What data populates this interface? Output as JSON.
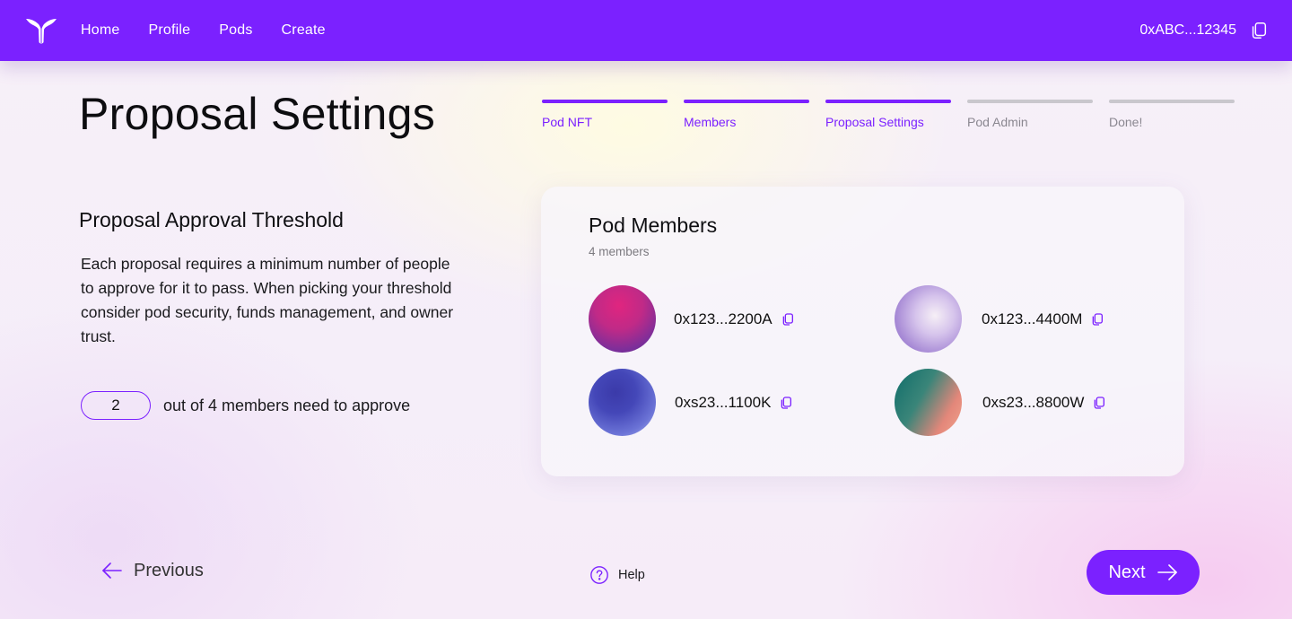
{
  "app": {
    "name": "Pods"
  },
  "nav": {
    "items": [
      {
        "label": "Home"
      },
      {
        "label": "Profile"
      },
      {
        "label": "Pods"
      },
      {
        "label": "Create"
      }
    ],
    "wallet": "0xABC...12345"
  },
  "page": {
    "title": "Proposal Settings"
  },
  "stepper": {
    "steps": [
      {
        "label": "Pod NFT",
        "state": "done"
      },
      {
        "label": "Members",
        "state": "done"
      },
      {
        "label": "Proposal Settings",
        "state": "active"
      },
      {
        "label": "Pod Admin",
        "state": "pending"
      },
      {
        "label": "Done!",
        "state": "pending"
      }
    ]
  },
  "threshold": {
    "title": "Proposal Approval Threshold",
    "description": "Each proposal requires a minimum number of people to approve for it to pass. When picking your threshold consider pod security, funds management, and owner trust.",
    "value": "2",
    "suffix": "out of 4 members need to approve"
  },
  "members_card": {
    "title": "Pod Members",
    "count_text": "4 members",
    "members": [
      {
        "address": "0x123...2200A"
      },
      {
        "address": "0x123...4400M"
      },
      {
        "address": "0xs23...1100K"
      },
      {
        "address": "0xs23...8800W"
      }
    ]
  },
  "footer": {
    "previous_label": "Previous",
    "help_label": "Help",
    "next_label": "Next"
  },
  "colors": {
    "accent": "#7b21ff",
    "inactive_step": "#c9c7cd"
  },
  "icons": {
    "logo": "whale-tail-icon",
    "copy": "copy-icon",
    "previous": "arrow-left-icon",
    "help": "help-circle-icon",
    "next": "arrow-right-icon"
  }
}
